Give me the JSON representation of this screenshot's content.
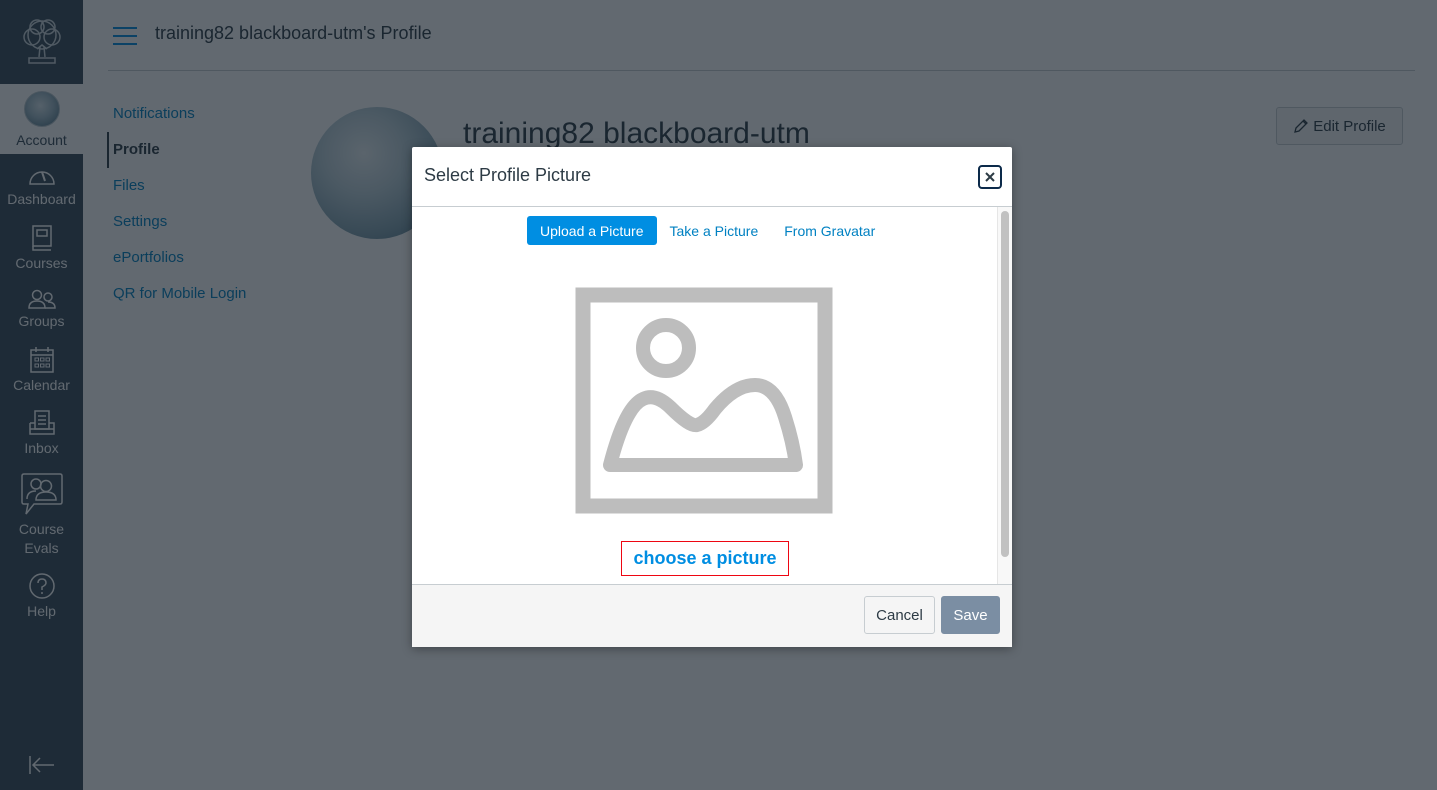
{
  "global_nav": {
    "logo": "tree-logo-icon",
    "items": [
      {
        "label": "Account",
        "icon": "avatar"
      },
      {
        "label": "Dashboard",
        "icon": "dashboard-icon"
      },
      {
        "label": "Courses",
        "icon": "courses-icon"
      },
      {
        "label": "Groups",
        "icon": "groups-icon"
      },
      {
        "label": "Calendar",
        "icon": "calendar-icon"
      },
      {
        "label": "Inbox",
        "icon": "inbox-icon"
      },
      {
        "label": "Course",
        "label2": "Evals",
        "icon": "course-evals-icon"
      },
      {
        "label": "Help",
        "icon": "help-icon"
      }
    ],
    "collapse_icon": "collapse-nav-icon"
  },
  "header": {
    "breadcrumb": "training82 blackboard-utm's Profile"
  },
  "left_menu": {
    "items": [
      {
        "label": "Notifications",
        "active": false
      },
      {
        "label": "Profile",
        "active": true
      },
      {
        "label": "Files",
        "active": false
      },
      {
        "label": "Settings",
        "active": false
      },
      {
        "label": "ePortfolios",
        "active": false
      },
      {
        "label": "QR for Mobile Login",
        "active": false
      }
    ]
  },
  "profile": {
    "name": "training82 blackboard-utm",
    "edit_label": "Edit Profile"
  },
  "dialog": {
    "title": "Select Profile Picture",
    "tabs": [
      {
        "label": "Upload a Picture",
        "active": true
      },
      {
        "label": "Take a Picture",
        "active": false
      },
      {
        "label": "From Gravatar",
        "active": false
      }
    ],
    "choose_label": "choose a picture",
    "cancel_label": "Cancel",
    "save_label": "Save"
  },
  "colors": {
    "nav_bg": "#394b58",
    "link": "#0081c2",
    "primary": "#008ee2",
    "text": "#2d3b45",
    "save_disabled": "#7b8ea3",
    "focus_outline": "#ee0612"
  }
}
